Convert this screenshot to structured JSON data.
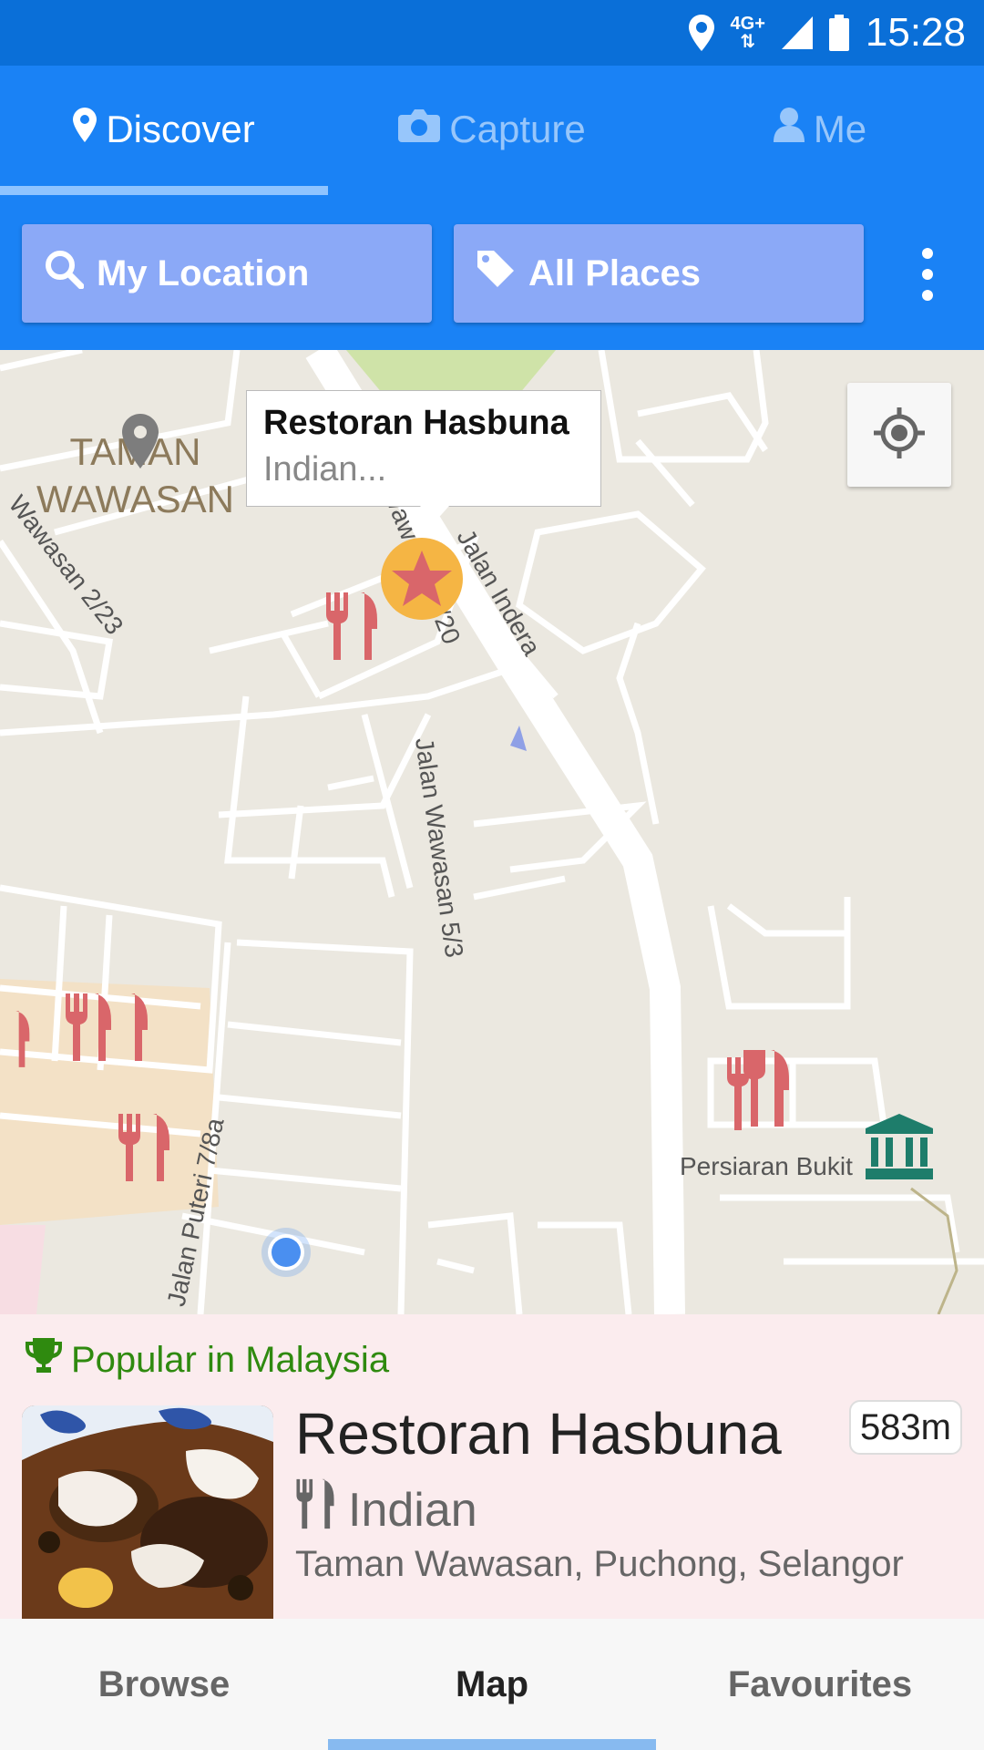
{
  "status_bar": {
    "time": "15:28",
    "network": "4G+",
    "icons": [
      "location-icon",
      "network-4g-icon",
      "signal-icon",
      "battery-icon"
    ]
  },
  "tabs": [
    {
      "label": "Discover",
      "icon": "map-marker-icon",
      "active": true
    },
    {
      "label": "Capture",
      "icon": "camera-icon",
      "active": false
    },
    {
      "label": "Me",
      "icon": "person-icon",
      "active": false
    }
  ],
  "filters": {
    "location_label": "My Location",
    "category_label": "All Places"
  },
  "map": {
    "callout_title": "Restoran Hasbuna",
    "callout_subtitle": "Indian...",
    "area_label_line1": "TAMAN",
    "area_label_line2": "WAWASAN",
    "street_labels": [
      "Wawasan 2/23",
      "Wawasan 2/20",
      "Jalan Indera",
      "Jalan Wawasan 5/3",
      "Jalan Puteri 7/8a",
      "Persiaran Bukit"
    ]
  },
  "card": {
    "popular_label": "Popular in Malaysia",
    "name": "Restoran Hasbuna",
    "distance": "583m",
    "cuisine": "Indian",
    "address": "Taman Wawasan, Puchong, Selangor"
  },
  "bottom_nav": [
    {
      "label": "Browse",
      "active": false
    },
    {
      "label": "Map",
      "active": true
    },
    {
      "label": "Favourites",
      "active": false
    }
  ],
  "colors": {
    "primary": "#1a82f5",
    "status_bar": "#0a6fd8",
    "filter_button": "#8ba9f7",
    "poi_red": "#d9666a",
    "card_bg": "#fbecee",
    "popular_green": "#2f8a0f",
    "user_dot": "#4a8ff0"
  }
}
